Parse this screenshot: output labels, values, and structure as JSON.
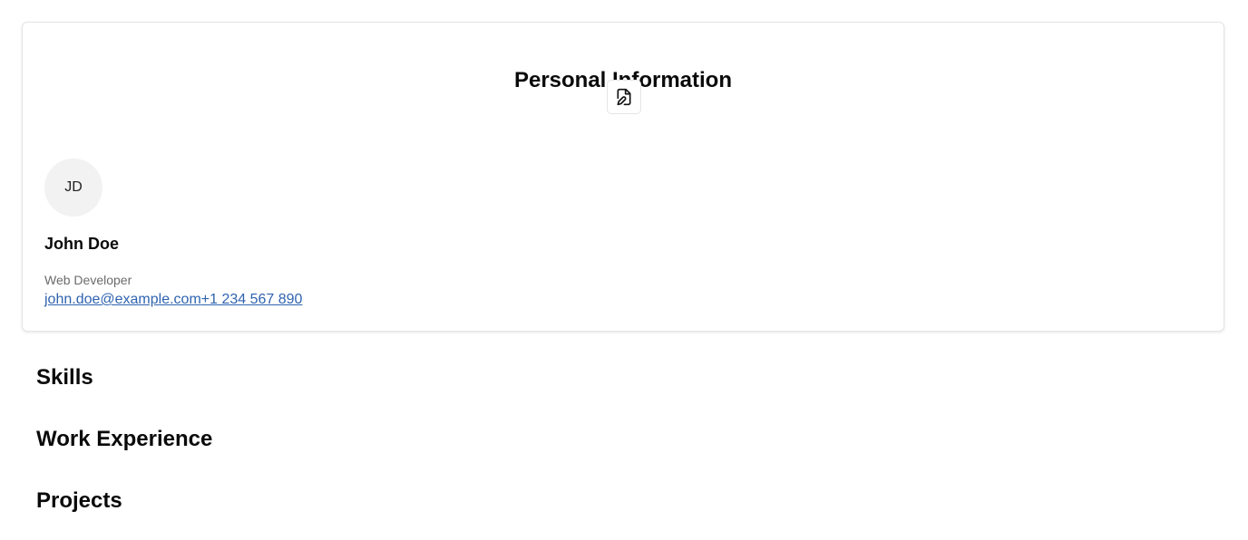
{
  "personal_info": {
    "title": "Personal Information",
    "edit_icon": "file-edit-icon",
    "avatar_initials": "JD",
    "name": "John Doe",
    "role": "Web Developer",
    "email": "john.doe@example.com",
    "phone": "+1 234 567 890"
  },
  "sections": {
    "skills": "Skills",
    "work_experience": "Work Experience",
    "projects": "Projects"
  },
  "colors": {
    "link": "#2f63b0",
    "muted_text": "#6b6b6b",
    "avatar_bg": "#f2f2f2"
  }
}
